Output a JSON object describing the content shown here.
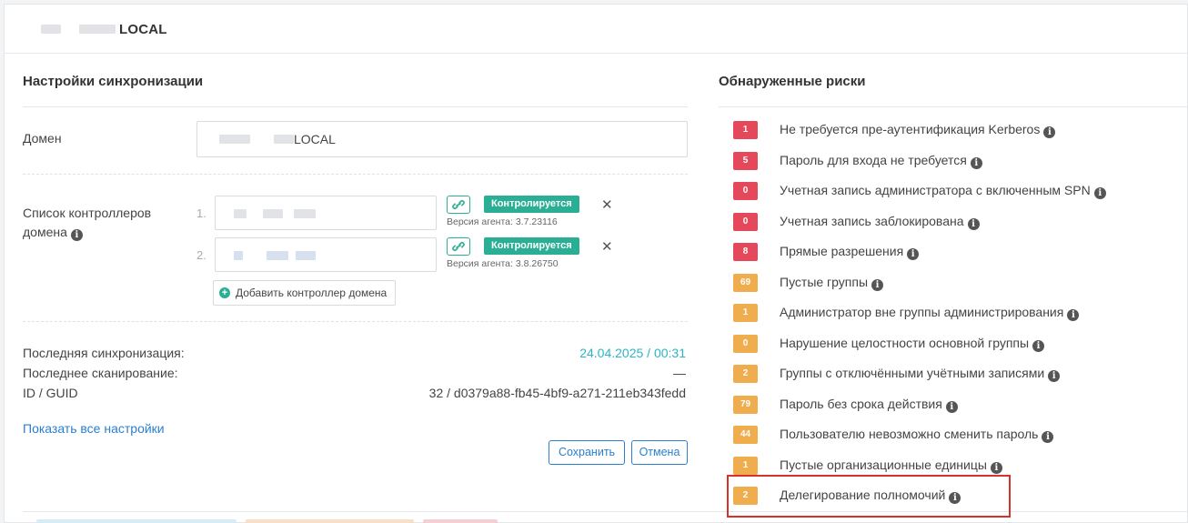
{
  "header": {
    "title": "LOCAL"
  },
  "sync": {
    "title": "Настройки синхронизации",
    "domain_label": "Домен",
    "domain_value": "LOCAL",
    "dc_list_label": "Список контроллеров домена",
    "controllers": [
      {
        "index": "1.",
        "status": "Контролируется",
        "agent_version": "Версия агента: 3.7.23116"
      },
      {
        "index": "2.",
        "status": "Контролируется",
        "agent_version": "Версия агента: 3.8.26750"
      }
    ],
    "add_dc_label": "Добавить контроллер домена",
    "last_sync_label": "Последняя синхронизация:",
    "last_sync_value": "24.04.2025 / 00:31",
    "last_scan_label": "Последнее сканирование:",
    "last_scan_value": "—",
    "id_label": "ID / GUID",
    "id_value": "32 / d0379a88-fb45-4bf9-a271-211eb343fedd",
    "show_all_link": "Показать все настройки",
    "save_label": "Сохранить",
    "cancel_label": "Отмена"
  },
  "risks": {
    "title": "Обнаруженные риски",
    "items": [
      {
        "count": "1",
        "label": "Не требуется пре-аутентификация Kerberos",
        "severity": "high"
      },
      {
        "count": "5",
        "label": "Пароль для входа не требуется",
        "severity": "high"
      },
      {
        "count": "0",
        "label": "Учетная запись администратора с включенным SPN",
        "severity": "high"
      },
      {
        "count": "0",
        "label": "Учетная запись заблокирована",
        "severity": "high"
      },
      {
        "count": "8",
        "label": "Прямые разрешения",
        "severity": "high"
      },
      {
        "count": "69",
        "label": "Пустые группы",
        "severity": "medium"
      },
      {
        "count": "1",
        "label": "Администратор вне группы администрирования",
        "severity": "medium"
      },
      {
        "count": "0",
        "label": "Нарушение целостности основной группы",
        "severity": "medium"
      },
      {
        "count": "2",
        "label": "Группы с отключёнными учётными записями",
        "severity": "medium"
      },
      {
        "count": "79",
        "label": "Пароль без срока действия",
        "severity": "medium"
      },
      {
        "count": "44",
        "label": "Пользователю невозможно сменить пароль",
        "severity": "medium"
      },
      {
        "count": "1",
        "label": "Пустые организационные единицы",
        "severity": "medium"
      },
      {
        "count": "2",
        "label": "Делегирование полномочий",
        "severity": "medium"
      }
    ]
  },
  "colors": {
    "high": "#e5485a",
    "medium": "#f0ad4e",
    "accent": "#2aae94",
    "link": "#2a7fcf",
    "sync_value": "#2db5c5"
  },
  "icons": {
    "link": "link-icon",
    "remove": "close-icon",
    "add": "plus-circle-icon",
    "info": "info-icon"
  }
}
